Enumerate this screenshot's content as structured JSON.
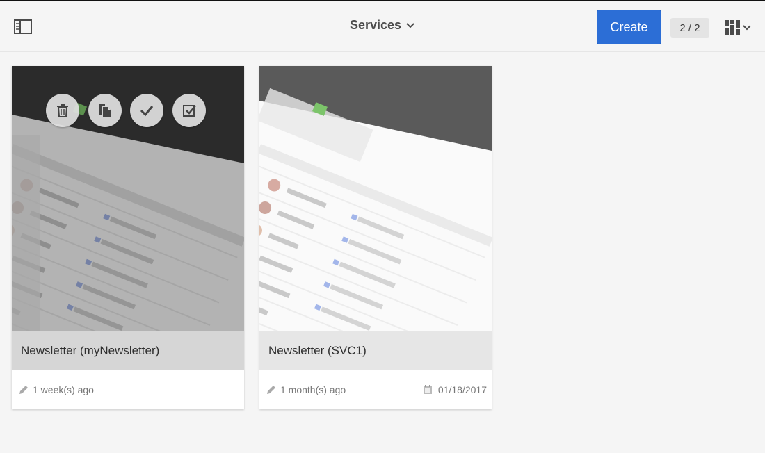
{
  "toolbar": {
    "title": "Services",
    "create_label": "Create",
    "count": "2 / 2"
  },
  "icons": {
    "rail": "sidebar-toggle-icon",
    "title_chevron": "chevron-down-icon",
    "view": "card-view-icon",
    "edit": "pencil-icon",
    "date": "calendar-icon",
    "quick_actions": [
      "trash-icon",
      "copy-icon",
      "checkmark-icon",
      "select-icon"
    ]
  },
  "colors": {
    "accent": "#2c6ed6",
    "background": "#f5f5f5",
    "title_band": "#e6e6e6"
  },
  "cards": [
    {
      "title": "Newsletter (myNewsletter)",
      "modified": "1 week(s) ago",
      "date": ""
    },
    {
      "title": "Newsletter (SVC1)",
      "modified": "1 month(s) ago",
      "date": "01/18/2017"
    }
  ]
}
